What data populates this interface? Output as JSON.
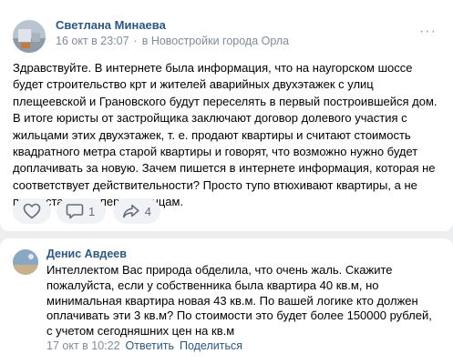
{
  "post": {
    "author": "Светлана Минаева",
    "date": "16 окт в 23:07",
    "separator": "·",
    "group": "в Новостройки города Орла",
    "menu": "···",
    "text": "Здравствуйте. В интернете была информация, что на наугорском шоссе будет строительство крт и жителей аварийных двухэтажек с улиц плещеевской и Грановского будут переселять в первый построившейся дом. В итоге юристы от застройщика заключают договор долевого участия с жильцами этих двухэтажек, т. е. продают квартиры и считают стоимость квадратного метра старой квартиры и говорят, что возможно нужно будет доплачивать за новую. Зачем пишется в интернете информация, которая не соответствует действительности? Просто тупо втюхивают квартиры, а не предоставляют переселенцам.",
    "actions": {
      "like_icon": "heart-icon",
      "comment_icon": "comment-icon",
      "comment_count": "1",
      "share_icon": "share-icon",
      "share_count": "4"
    }
  },
  "comment": {
    "author": "Денис Авдеев",
    "text": "Интеллектом Вас природа обделила, что очень жаль. Скажите пожалуйста, если у собственника была квартира 40 кв.м, но минимальная квартира новая 43 кв.м. По вашей логике кто должен оплачивать эти 3 кв.м? По стоимости это будет более 150000 рублей, с учетом сегодняшних цен на кв.м",
    "date": "17 окт в 10:22",
    "reply": "Ответить",
    "share": "Поделиться"
  },
  "colors": {
    "link": "#2a5885",
    "meta": "#818c99",
    "icon": "#626d7a",
    "page_bg": "#edeef0"
  }
}
